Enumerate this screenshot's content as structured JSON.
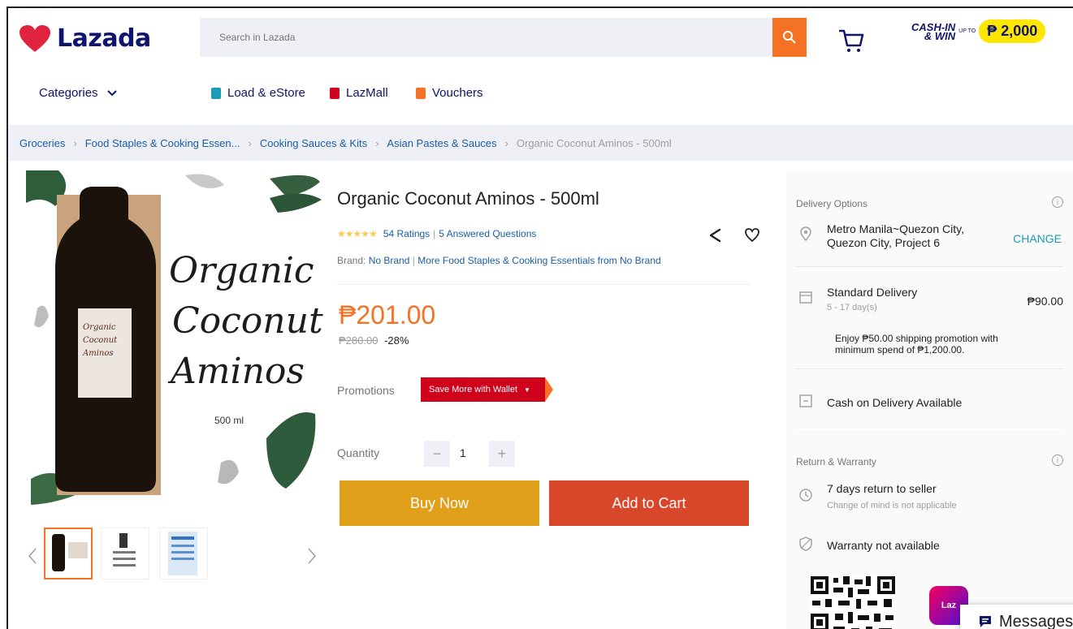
{
  "header": {
    "logo_text": "Lazada",
    "search_placeholder": "Search in Lazada",
    "promo_line1": "CASH-IN",
    "promo_line2": "& WIN",
    "promo_upto": "UP TO",
    "promo_amount": "₱ 2,000",
    "brand_color": "#0f146d",
    "accent_color": "#f57224"
  },
  "nav": {
    "categories": "Categories",
    "items": [
      {
        "label": "Load & eStore",
        "icon": "phone-icon",
        "color": "#1a9cb7"
      },
      {
        "label": "LazMall",
        "icon": "lazmall-icon",
        "color": "#d0021b"
      },
      {
        "label": "Vouchers",
        "icon": "voucher-icon",
        "color": "#f57224"
      }
    ]
  },
  "breadcrumb": [
    "Groceries",
    "Food Staples & Cooking Essen...",
    "Cooking Sauces & Kits",
    "Asian Pastes & Sauces",
    "Organic Coconut Aminos - 500ml"
  ],
  "product": {
    "image_caption_1": "Organic",
    "image_caption_2": "Coconut",
    "image_caption_3": "Aminos",
    "image_size": "500 ml",
    "label_text_1": "Organic",
    "label_text_2": "Coconut",
    "label_text_3": "Aminos",
    "title": "Organic Coconut Aminos - 500ml",
    "stars": "★★★★★",
    "ratings": "54 Ratings",
    "questions": "5 Answered Questions",
    "brand_label": "Brand:",
    "brand_name": "No Brand",
    "brand_more": "More Food Staples & Cooking Essentials from No Brand",
    "price": "₱201.00",
    "old_price": "₱280.00",
    "discount": "-28%",
    "promotions_label": "Promotions",
    "promotion_tag": "Save More with Wallet",
    "quantity_label": "Quantity",
    "quantity": "1",
    "buy_now": "Buy Now",
    "add_to_cart": "Add to Cart"
  },
  "delivery": {
    "heading": "Delivery Options",
    "location_line1": "Metro Manila~Quezon City,",
    "location_line2": "Quezon City, Project 6",
    "change": "CHANGE",
    "standard": "Standard Delivery",
    "standard_days": "5 - 17 day(s)",
    "standard_fee": "₱90.00",
    "promo_note_line1": "Enjoy ₱50.00 shipping promotion with",
    "promo_note_line2": "minimum spend of ₱1,200.00.",
    "cod": "Cash on Delivery Available"
  },
  "warranty": {
    "heading": "Return & Warranty",
    "return": "7 days return to seller",
    "return_sub": "Change of mind is not applicable",
    "warranty": "Warranty not available"
  },
  "app_badge": "Laz",
  "messages": "Messages"
}
